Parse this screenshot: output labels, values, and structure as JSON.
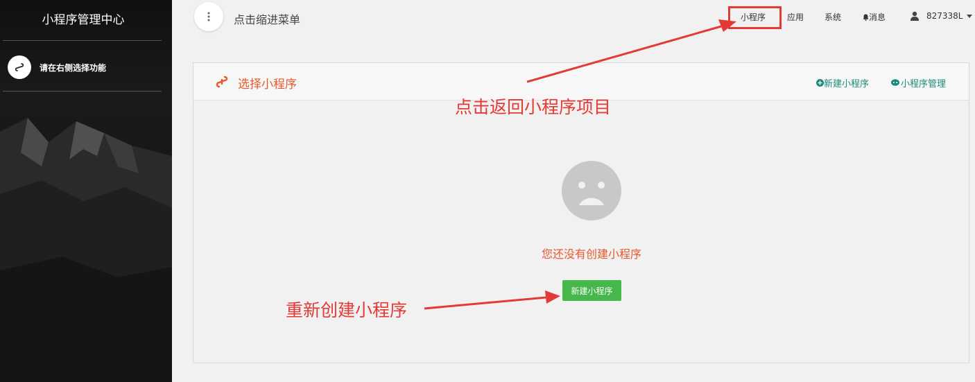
{
  "sidebar": {
    "title": "小程序管理中心",
    "item_label": "请在右侧选择功能",
    "item_icon": "miniprogram-icon"
  },
  "header": {
    "menu_button_icon": "vertical-dots-icon",
    "menu_text": "点击缩进菜单",
    "nav": {
      "miniapp": "小程序",
      "app": "应用",
      "system": "系统",
      "messages": "消息",
      "user": "827338L"
    }
  },
  "panel": {
    "title": "选择小程序",
    "new_link": "新建小程序",
    "manage_link": "小程序管理",
    "empty_text": "您还没有创建小程序",
    "create_button": "新建小程序"
  },
  "annotations": {
    "top": "点击返回小程序项目",
    "bottom": "重新创建小程序"
  },
  "colors": {
    "accent_orange": "#e8582b",
    "link_teal": "#1a8a7a",
    "button_green": "#46b74a",
    "annotation_red": "#e53935"
  }
}
